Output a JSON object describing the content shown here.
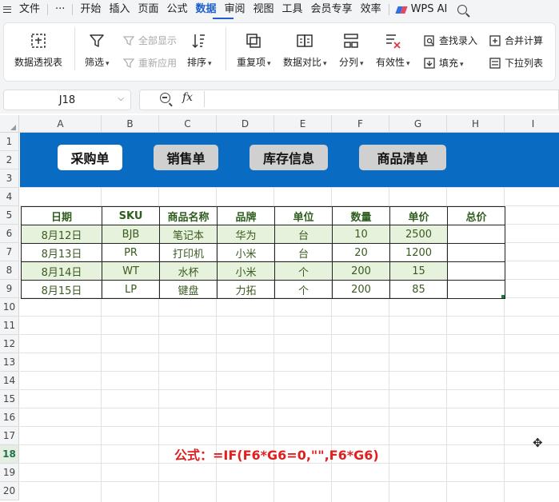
{
  "menu": {
    "file": "文件",
    "more": "···",
    "tabs": [
      "开始",
      "插入",
      "页面",
      "公式",
      "数据",
      "审阅",
      "视图",
      "工具",
      "会员专享",
      "效率"
    ],
    "active_tab": "数据",
    "ai": "WPS AI"
  },
  "ribbon": {
    "pivot": "数据透视表",
    "filter": "筛选",
    "show_all": "全部显示",
    "reapply": "重新应用",
    "sort": "排序",
    "duplicates": "重复项",
    "compare": "数据对比",
    "split": "分列",
    "validity": "有效性",
    "find_entry": "查找录入",
    "fill": "填充",
    "consolidate": "合并计算",
    "dropdown_list": "下拉列表"
  },
  "formula_bar": {
    "name_box": "J18",
    "fx": "fx",
    "content": ""
  },
  "sheet": {
    "columns": [
      "A",
      "B",
      "C",
      "D",
      "E",
      "F",
      "G",
      "H",
      "I"
    ],
    "rows": [
      "1",
      "2",
      "3",
      "4",
      "5",
      "6",
      "7",
      "8",
      "9",
      "10",
      "11",
      "12",
      "13",
      "14",
      "15",
      "16",
      "17",
      "18",
      "19",
      "20"
    ],
    "selected_row": "18",
    "nav_buttons": [
      "采购单",
      "销售单",
      "库存信息",
      "商品清单"
    ],
    "table": {
      "headers": [
        "日期",
        "SKU",
        "商品名称",
        "品牌",
        "单位",
        "数量",
        "单价",
        "总价"
      ],
      "rows": [
        [
          "8月12日",
          "BJB",
          "笔记本",
          "华为",
          "台",
          "10",
          "2500",
          ""
        ],
        [
          "8月13日",
          "PR",
          "打印机",
          "小米",
          "台",
          "20",
          "1200",
          ""
        ],
        [
          "8月14日",
          "WT",
          "水杯",
          "小米",
          "个",
          "200",
          "15",
          ""
        ],
        [
          "8月15日",
          "LP",
          "键盘",
          "力拓",
          "个",
          "200",
          "85",
          ""
        ]
      ]
    },
    "formula_note": "公式：=IF(F6*G6=0,\"\",F6*G6)"
  },
  "colors": {
    "banner": "#0a6bc2",
    "header_text": "#2e5e1d",
    "alt_row": "#e7f2dc",
    "formula_note": "#e02020",
    "active_tab": "#1f5fcb"
  }
}
